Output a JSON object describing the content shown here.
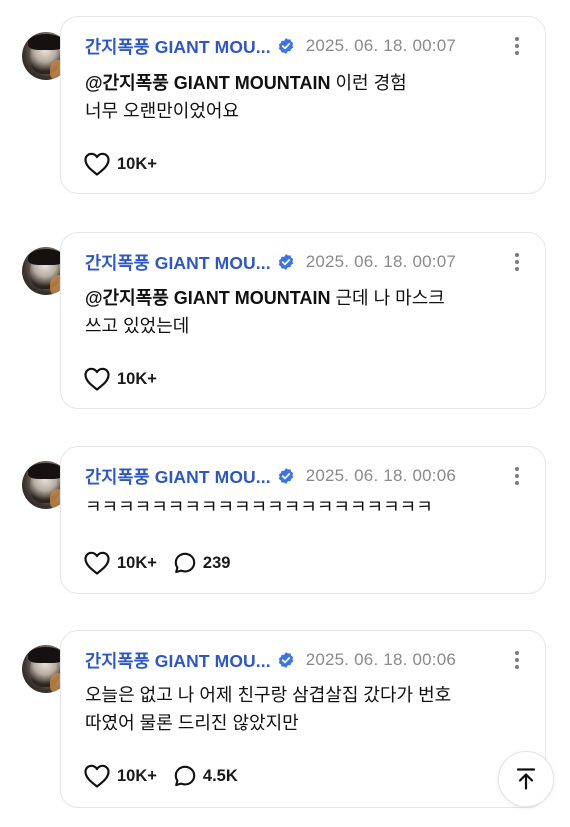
{
  "comments": [
    {
      "author": "간지폭풍 GIANT MOU...",
      "timestamp": "2025. 06. 18. 00:07",
      "mention": "@간지폭풍 GIANT MOUNTAIN",
      "line1_rest": " 이런 경험",
      "line2": "너무 오랜만이었어요",
      "likes": "10K+",
      "replies": ""
    },
    {
      "author": "간지폭풍 GIANT MOU...",
      "timestamp": "2025. 06. 18. 00:07",
      "mention": "@간지폭풍 GIANT MOUNTAIN",
      "line1_rest": " 근데 나 마스크",
      "line2": "쓰고 있었는데",
      "likes": "10K+",
      "replies": ""
    },
    {
      "author": "간지폭풍 GIANT MOU...",
      "timestamp": "2025. 06. 18. 00:06",
      "mention": "",
      "line1_rest": "ㅋㅋㅋㅋㅋㅋㅋㅋㅋㅋㅋㅋㅋㅋㅋㅋㅋㅋㅋㅋㅋ",
      "line2": "",
      "likes": "10K+",
      "replies": "239"
    },
    {
      "author": "간지폭풍 GIANT MOU...",
      "timestamp": "2025. 06. 18. 00:06",
      "mention": "",
      "line1_rest": "오늘은 없고 나 어제 친구랑 삼겹살집 갔다가 번호",
      "line2": "따였어 물론 드리진 않았지만",
      "likes": "10K+",
      "replies": "4.5K"
    }
  ],
  "icons": {
    "verified": "verified-badge-icon",
    "more": "more-vertical-icon",
    "like": "heart-icon",
    "reply": "speech-bubble-icon",
    "scroll_top": "arrow-up-icon"
  },
  "colors": {
    "author": "#2d57c6",
    "verified": "#3a74e6",
    "timestamp": "#8a8a8a",
    "border": "#e6e6e6"
  }
}
